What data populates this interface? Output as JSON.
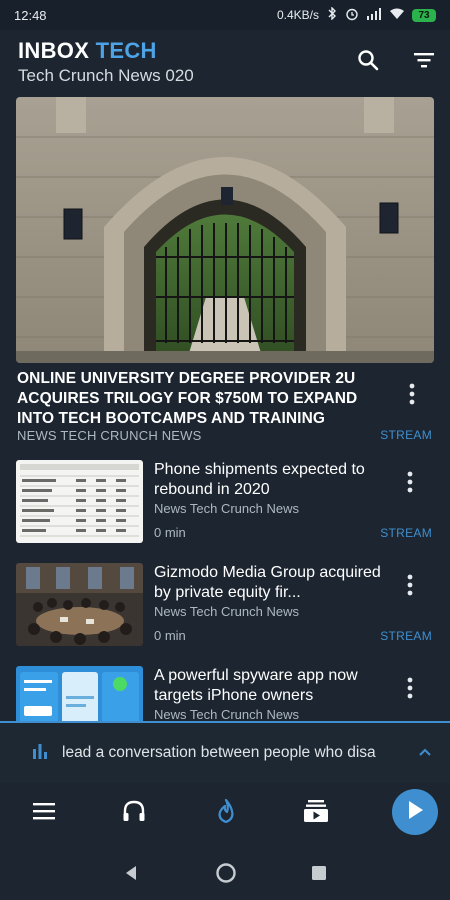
{
  "status_bar": {
    "time": "12:48",
    "network_speed": "0.4KB/s",
    "battery": "73"
  },
  "header": {
    "title_part1": "INBOX",
    "title_part2": "TECH",
    "subtitle": "Tech Crunch News 020",
    "search_icon": "search-icon",
    "filter_icon": "filter-icon"
  },
  "hero": {
    "title": "ONLINE UNIVERSITY DEGREE PROVIDER 2U ACQUIRES TRILOGY FOR $750M TO EXPAND INTO TECH BOOTCAMPS AND TRAINING",
    "source": "NEWS TECH CRUNCH NEWS",
    "stream_label": "STREAM"
  },
  "articles": [
    {
      "title": "Phone shipments expected to rebound in 2020",
      "source": "News Tech Crunch News",
      "time": "0 min",
      "stream_label": "STREAM"
    },
    {
      "title": "Gizmodo Media Group acquired by private equity fir...",
      "source": "News Tech Crunch News",
      "time": "0 min",
      "stream_label": "STREAM"
    },
    {
      "title": "A powerful spyware app now targets iPhone owners",
      "source": "News Tech Crunch News",
      "time": "",
      "stream_label": ""
    }
  ],
  "now_playing": {
    "text": "lead a conversation between people who disa"
  },
  "bottom_nav": {
    "items": [
      "menu-icon",
      "headphones-icon",
      "flame-icon",
      "inbox-play-icon"
    ],
    "play_icon": "play-icon"
  },
  "colors": {
    "background": "#1c2530",
    "accent": "#3f8fd0",
    "title_accent": "#4da3e6"
  }
}
